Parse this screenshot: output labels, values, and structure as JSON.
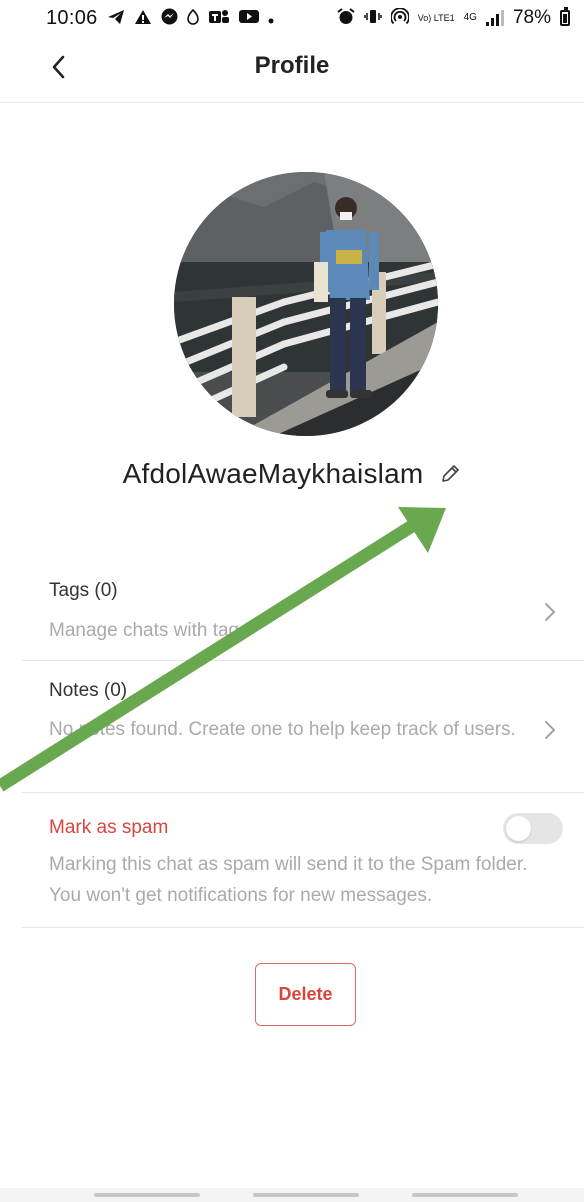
{
  "status_bar": {
    "time": "10:06",
    "battery": "78%",
    "network_label": "Vo) LTE1",
    "network_type": "4G",
    "left_icons": [
      "telegram-icon",
      "warning-icon",
      "messenger-icon",
      "location-icon",
      "teams-icon",
      "youtube-icon",
      "dot-icon"
    ],
    "right_icons": [
      "alarm-icon",
      "vibrate-icon",
      "hotspot-icon",
      "signal-icon",
      "battery-icon"
    ]
  },
  "header": {
    "title": "Profile",
    "back_icon": "chevron-left-icon"
  },
  "profile": {
    "name": "AfdolAwaeMaykhaislam",
    "edit_icon": "pencil-icon"
  },
  "tags": {
    "title": "Tags (0)",
    "description": "Manage chats with tags"
  },
  "notes": {
    "title": "Notes (0)",
    "description": "No notes found. Create one to help keep track of users."
  },
  "spam": {
    "title": "Mark as spam",
    "description": "Marking this chat as spam will send it to the Spam folder. You won't get notifications for new messages.",
    "enabled": false
  },
  "actions": {
    "delete_label": "Delete"
  },
  "colors": {
    "danger": "#d8453f",
    "annotation_arrow": "#6aa84f",
    "muted_text": "#aaaaaa",
    "divider": "#e6e6e6"
  }
}
